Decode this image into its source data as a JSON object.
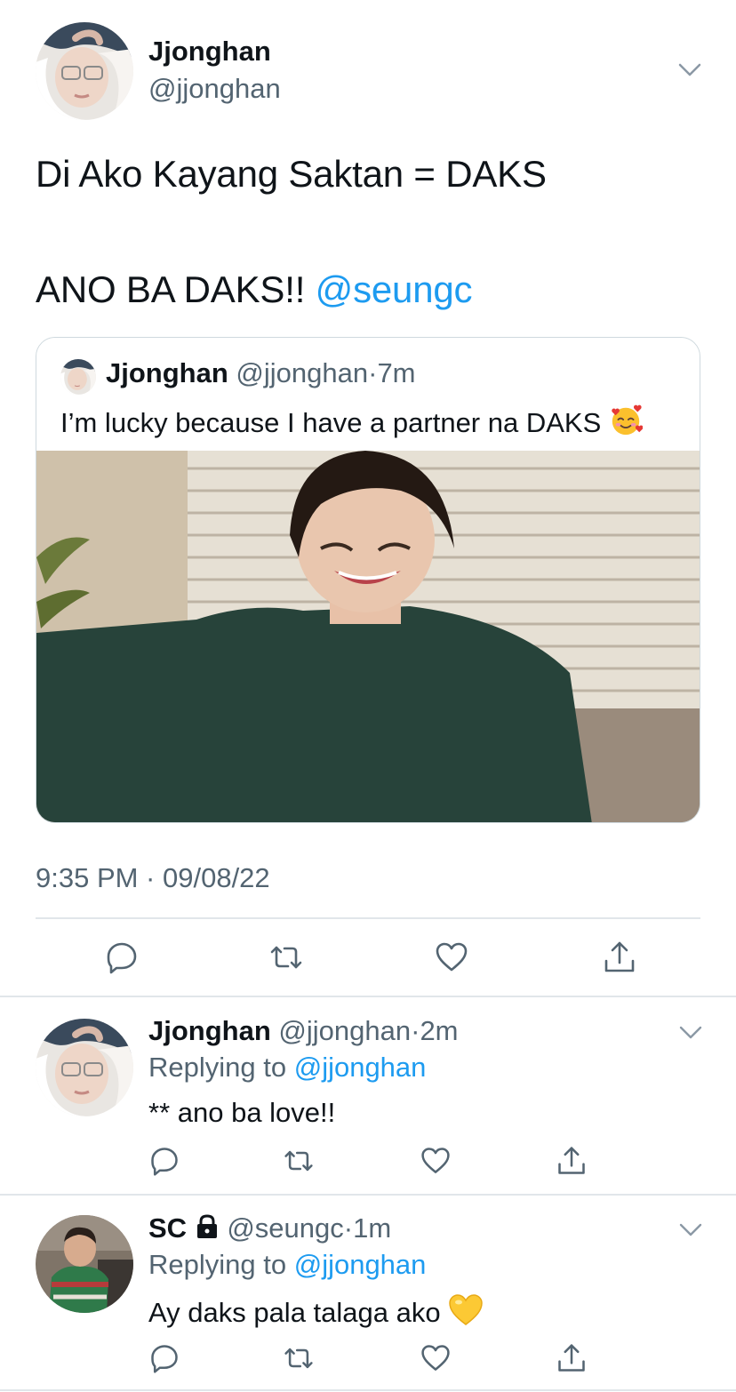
{
  "main_tweet": {
    "display_name": "Jjonghan",
    "handle": "@jjonghan",
    "text_line1": "Di Ako Kayang Saktan = DAKS",
    "text_line2": "ANO BA DAKS!! ",
    "mention": "@seungc",
    "timestamp": "9:35 PM · 09/08/22",
    "quote": {
      "display_name": "Jjonghan",
      "handle": "@jjonghan",
      "separator": "·",
      "time": "7m",
      "text": "I’m lucky because I have a partner na DAKS ",
      "emoji": "smiling-face-with-hearts"
    },
    "actions": [
      "reply-icon",
      "retweet-icon",
      "like-icon",
      "share-icon"
    ]
  },
  "replies": [
    {
      "display_name": "Jjonghan",
      "handle": "@jjonghan",
      "separator": "·",
      "time": "2m",
      "replying_prefix": "Replying to ",
      "replying_to": "@jjonghan",
      "text": "** ano ba love!!"
    },
    {
      "display_name": "SC",
      "protected": true,
      "handle": "@seungc",
      "separator": "·",
      "time": "1m",
      "replying_prefix": "Replying to ",
      "replying_to": "@jjonghan",
      "text": "Ay daks pala talaga ako ",
      "emoji": "yellow-heart"
    }
  ],
  "colors": {
    "text": "#0f1419",
    "muted": "#536471",
    "link": "#1d9bf0",
    "divider": "#e1e6ea"
  }
}
